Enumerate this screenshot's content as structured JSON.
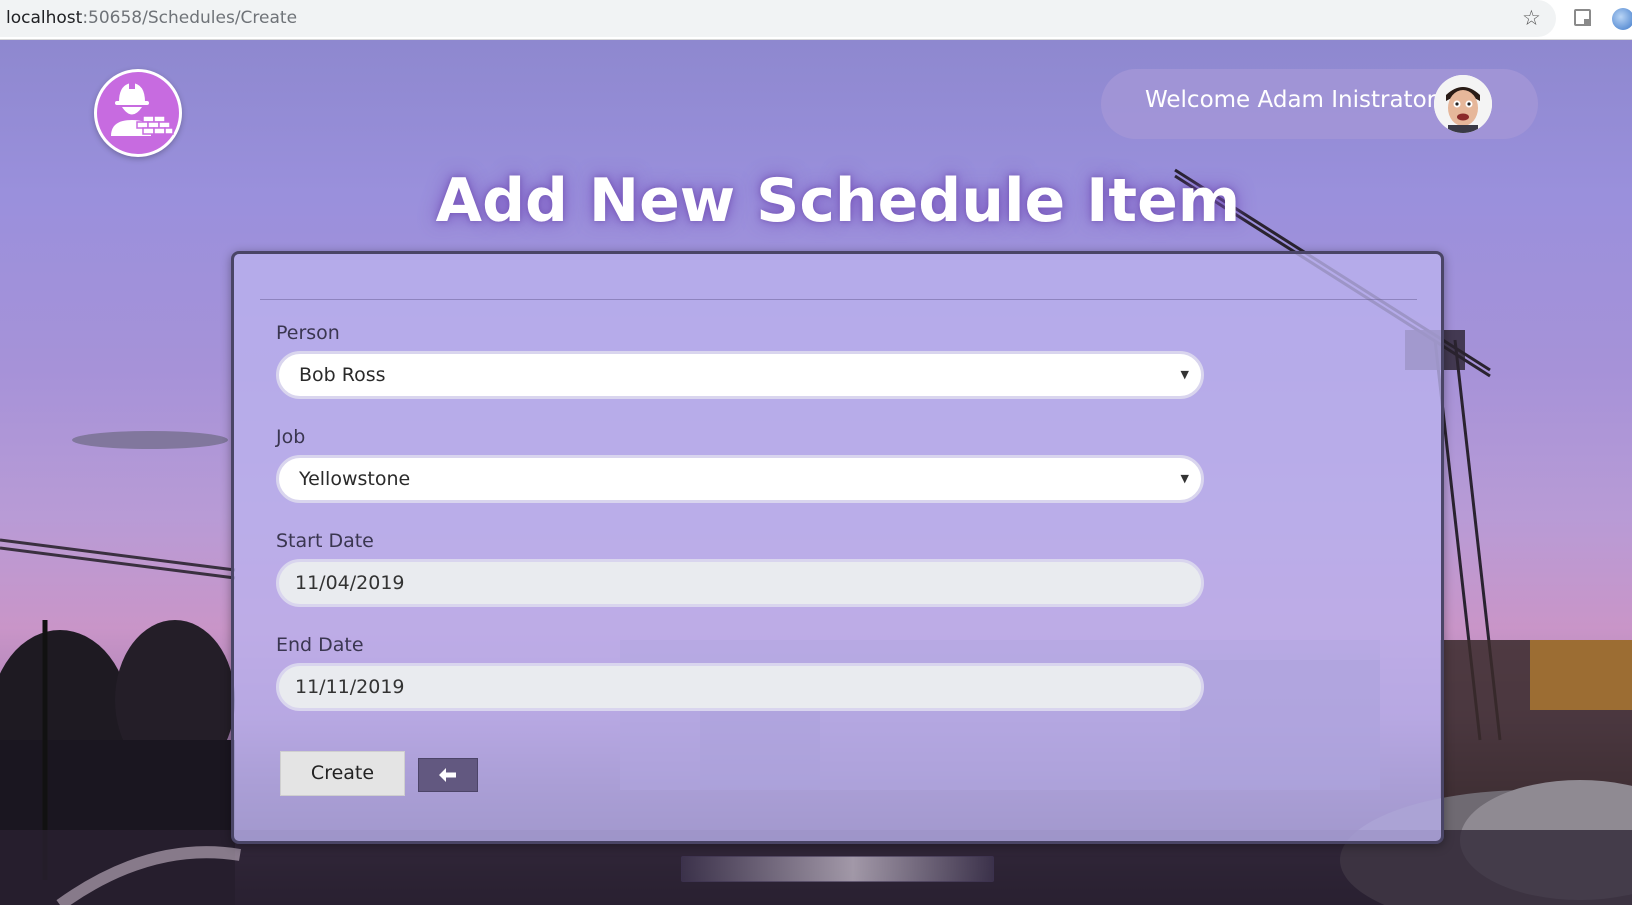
{
  "browser": {
    "url_host": "localhost",
    "url_path": ":50658/Schedules/Create",
    "bookmark_icon": "star-icon",
    "extension_icons": [
      "extension-icon",
      "profile-sync-icon"
    ]
  },
  "header": {
    "logo_icon": "construction-worker-bricks-icon",
    "welcome_text": "Welcome Adam Inistrator",
    "avatar_icon": "user-avatar"
  },
  "page": {
    "title": "Add New Schedule Item"
  },
  "form": {
    "person": {
      "label": "Person",
      "value": "Bob Ross"
    },
    "job": {
      "label": "Job",
      "value": "Yellowstone"
    },
    "start_date": {
      "label": "Start Date",
      "value": "11/04/2019"
    },
    "end_date": {
      "label": "End Date",
      "value": "11/11/2019"
    },
    "create_label": "Create",
    "back_icon": "arrow-left-icon"
  },
  "colors": {
    "logo_bg": "#c76be0",
    "card_bg": "#bab2ee",
    "back_button": "#625880",
    "title_glow": "#7850be"
  }
}
